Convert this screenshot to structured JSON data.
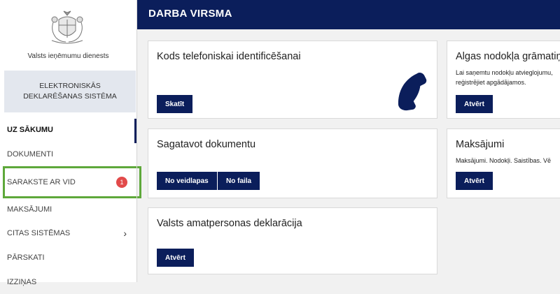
{
  "sidebar": {
    "agency_name": "Valsts ieņēmumu dienests",
    "eds_line1": "ELEKTRONISKĀS",
    "eds_line2": "DEKLARĒŠANAS SISTĒMA",
    "items": [
      {
        "label": "UZ SĀKUMU"
      },
      {
        "label": "DOKUMENTI"
      },
      {
        "label": "SARAKSTE AR VID",
        "badge": "1"
      },
      {
        "label": "MAKSĀJUMI"
      },
      {
        "label": "CITAS SISTĒMAS"
      },
      {
        "label": "PĀRSKATI"
      },
      {
        "label": "IZZIŅAS"
      }
    ]
  },
  "header": {
    "title": "DARBA VIRSMA"
  },
  "cards": {
    "phone_code": {
      "title": "Kods telefoniskai identificēšanai",
      "button": "Skatīt"
    },
    "tax_book": {
      "title": "Algas nodokļa grāmatiņa",
      "desc": "Lai saņemtu nodokļu atvieglojumu, reģistrējiet apgādājamos.",
      "button": "Atvērt"
    },
    "prepare_doc": {
      "title": "Sagatavot dokumentu",
      "button_form": "No veidlapas",
      "button_file": "No faila"
    },
    "payments": {
      "title": "Maksājumi",
      "desc": "Maksājumi. Nodokļi. Saistības. Vē",
      "button": "Atvērt"
    },
    "official_decl": {
      "title": "Valsts amatpersonas deklarācija",
      "button": "Atvērt"
    }
  },
  "colors": {
    "brand_navy": "#0b1e5b",
    "badge_red": "#e24a4a",
    "highlight_green": "#5ea83a"
  }
}
